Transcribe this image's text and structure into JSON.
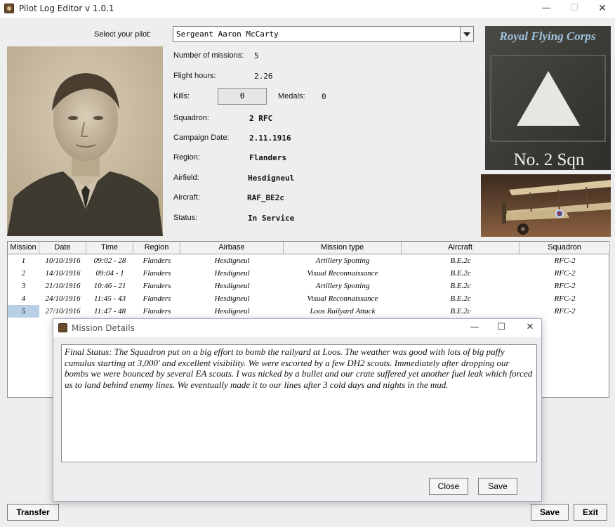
{
  "window": {
    "title": "Pilot Log Editor v 1.0.1",
    "minimize_glyph": "—",
    "maximize_glyph": "☐",
    "close_glyph": "✕"
  },
  "pilot": {
    "select_label": "Select your pilot:",
    "selected": "Sergeant Aaron McCarty",
    "missions_label": "Number of missions:",
    "missions": "5",
    "flight_hours_label": "Flight hours:",
    "flight_hours": "2.26",
    "kills_label": "Kills:",
    "kills": "0",
    "medals_label": "Medals:",
    "medals": "0",
    "squadron_label": "Squadron:",
    "squadron": "2 RFC",
    "campaign_date_label": "Campaign Date:",
    "campaign_date": "2.11.1916",
    "region_label": "Region:",
    "region": "Flanders",
    "airfield_label": "Airfield:",
    "airfield": "Hesdigneul",
    "aircraft_label": "Aircraft:",
    "aircraft": "RAF_BE2c",
    "status_label": "Status:",
    "status": "In Service"
  },
  "badge": {
    "corps_text": "Royal Flying Corps",
    "squadron_text": "No. 2 Sqn"
  },
  "table": {
    "columns": [
      "Mission",
      "Date",
      "Time",
      "Region",
      "Airbase",
      "Mission type",
      "Aircraft",
      "Squadron"
    ],
    "rows": [
      [
        "1",
        "10/10/1916",
        "09:02 - 28",
        "Flanders",
        "Hesdigneul",
        "Artillery Spotting",
        "B.E.2c",
        "RFC-2"
      ],
      [
        "2",
        "14/10/1916",
        "09:04 - 1",
        "Flanders",
        "Hesdigneul",
        "Visual Reconnaissance",
        "B.E.2c",
        "RFC-2"
      ],
      [
        "3",
        "21/10/1916",
        "10:46 - 21",
        "Flanders",
        "Hesdigneul",
        "Artillery Spotting",
        "B.E.2c",
        "RFC-2"
      ],
      [
        "4",
        "24/10/1916",
        "11:45 - 43",
        "Flanders",
        "Hesdigneul",
        "Visual Reconnaissance",
        "B.E.2c",
        "RFC-2"
      ],
      [
        "5",
        "27/10/1916",
        "11:47 - 48",
        "Flanders",
        "Hesdigneul",
        "Loos Railyard Attack",
        "B.E.2c",
        "RFC-2"
      ]
    ],
    "selected_row": 5
  },
  "buttons": {
    "transfer": "Transfer",
    "save": "Save",
    "exit": "Exit"
  },
  "dialog": {
    "title": "Mission Details",
    "minimize_glyph": "—",
    "maximize_glyph": "☐",
    "close_glyph": "✕",
    "text": " Final Status: The Squadron put on a big effort to bomb the railyard at Loos. The weather was good with lots of big puffy cumulus starting at 3,000' and excellent visibility. We were escorted by a few DH2 scouts. Immediately after dropping our bombs we were bounced by several EA scouts. I was nicked by a bullet and our crate suffered yet another fuel leak which forced us to land behind enemy lines. We eventually made it to our lines after 3 cold days and nights in the mud.",
    "close_label": "Close",
    "save_label": "Save"
  },
  "colors": {
    "window_bg": "#eeeeee",
    "selected_cell": "#b8cfe5",
    "dialog_border": "#9aa7bb"
  }
}
